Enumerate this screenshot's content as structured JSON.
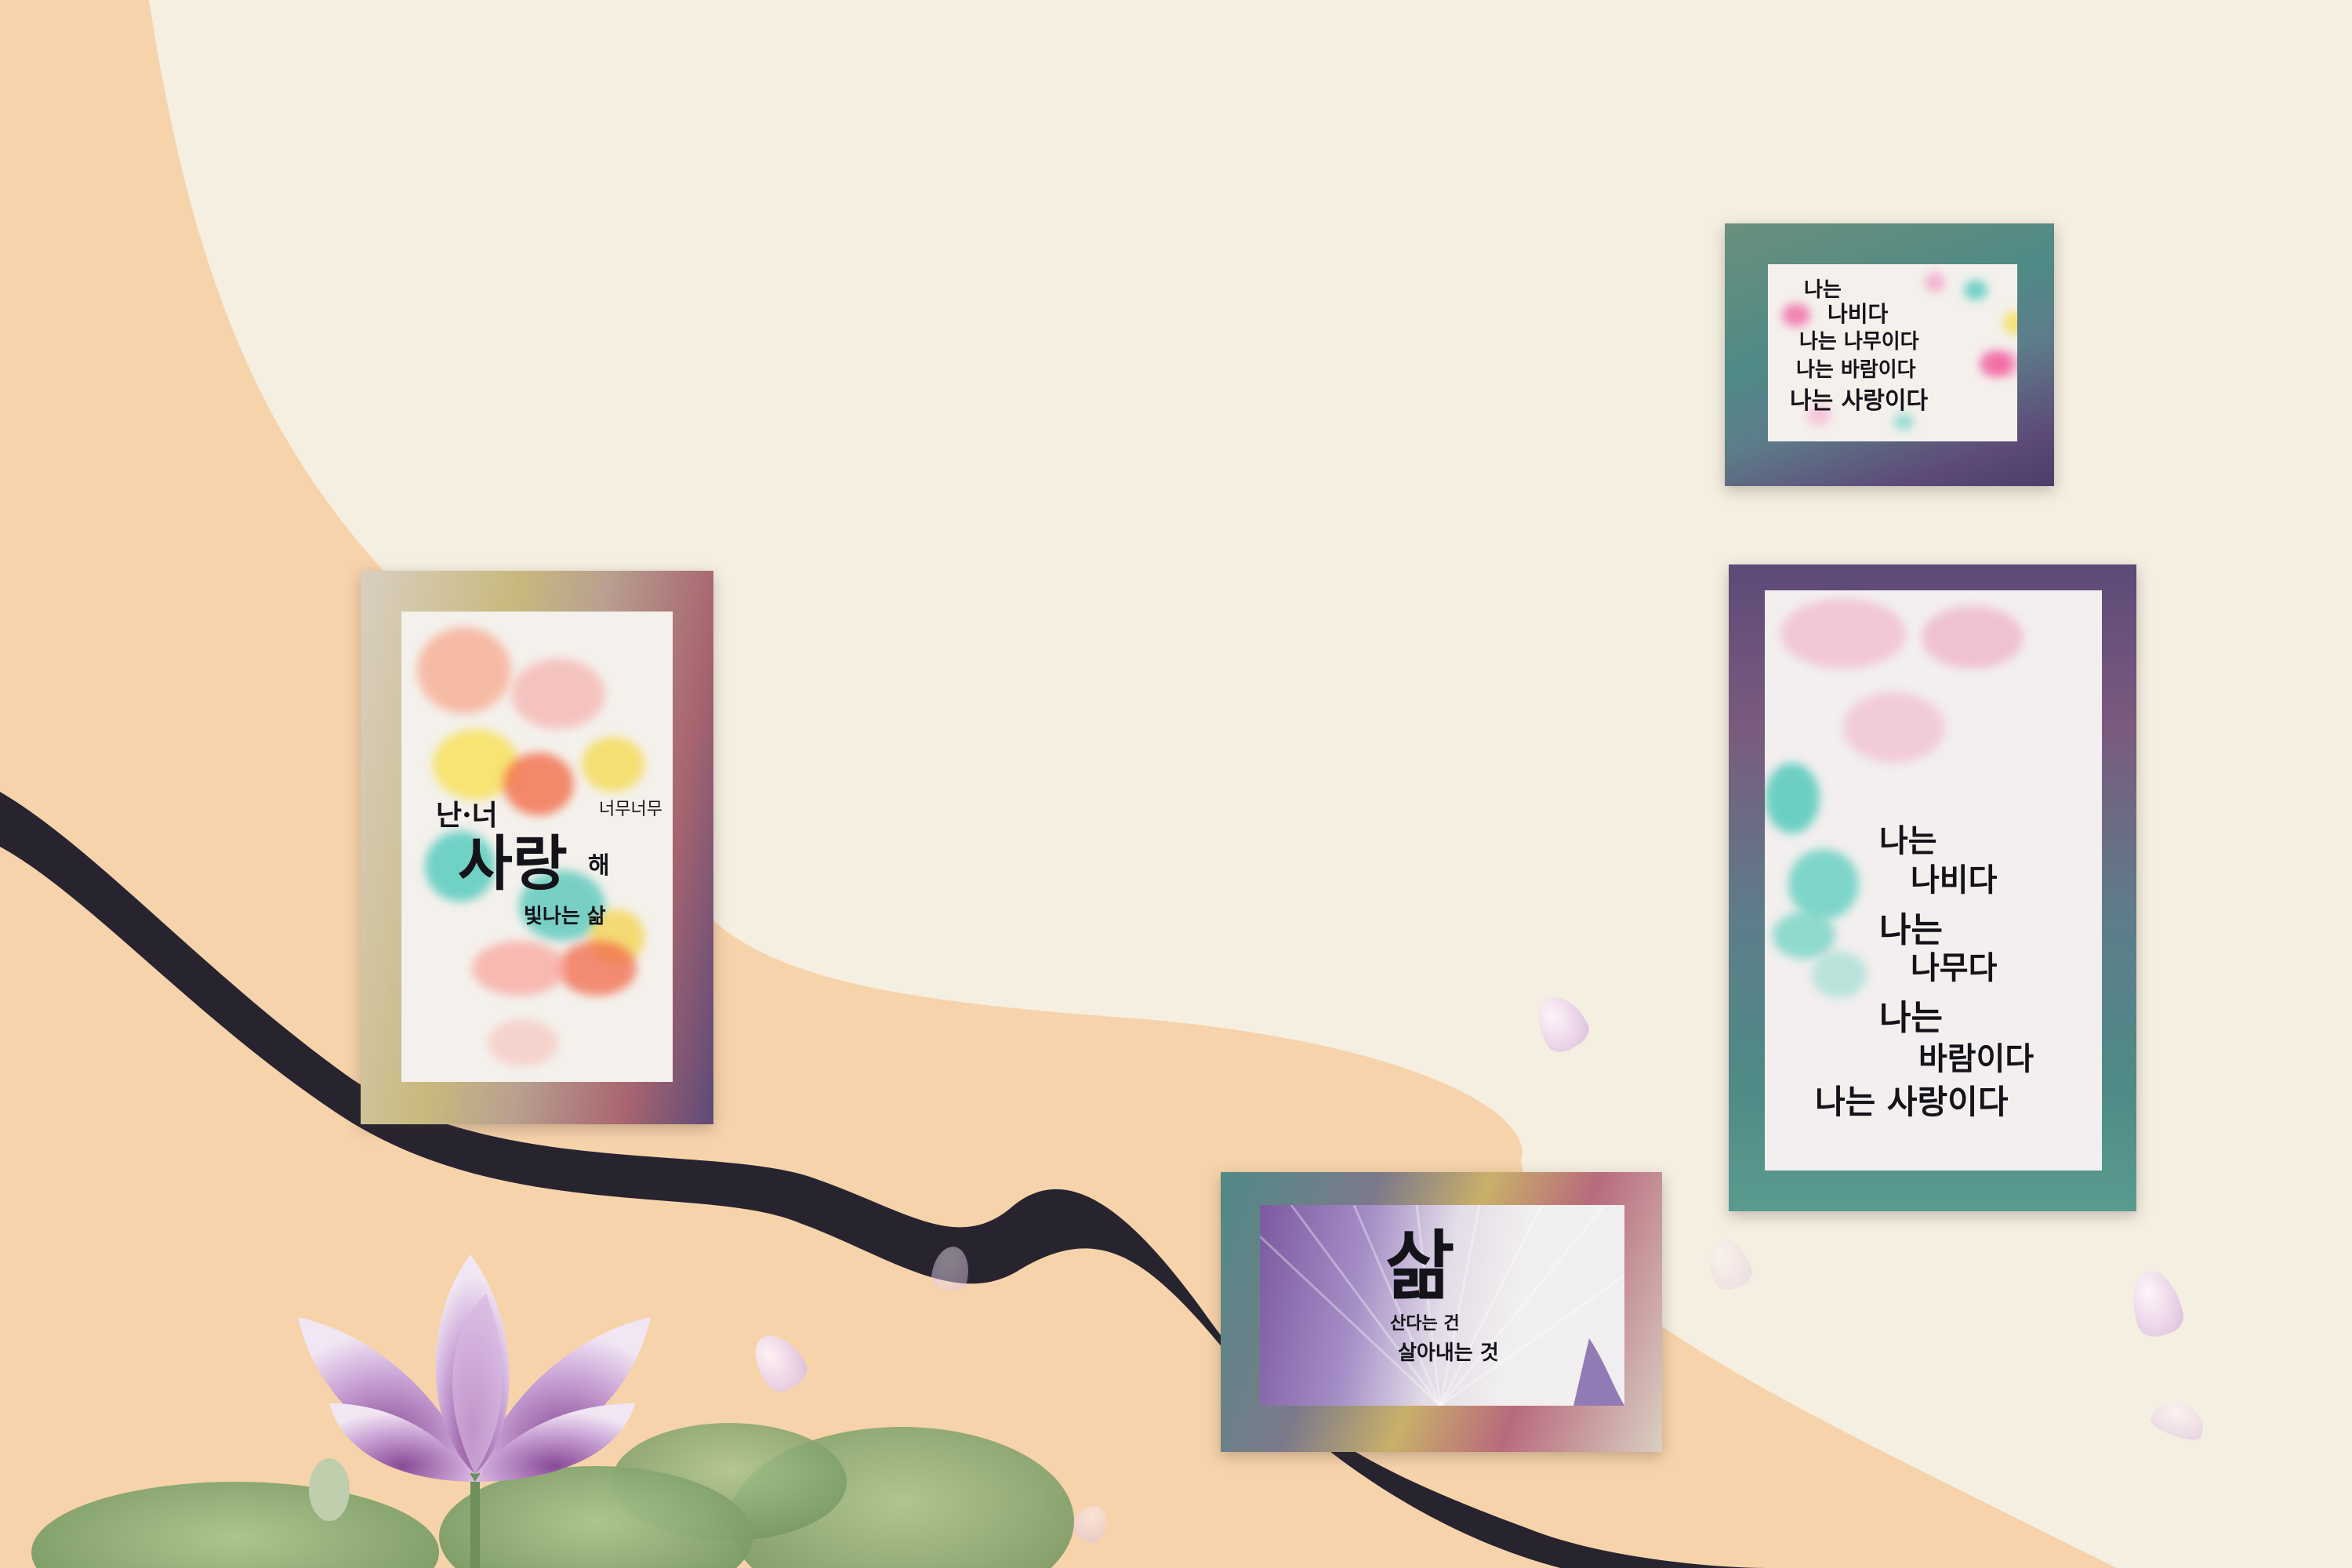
{
  "cards": {
    "left": {
      "line1": "난·너",
      "line2": "너무너무",
      "main": "사랑",
      "suffix": "해",
      "line4": "빛나는 삶"
    },
    "top_right": {
      "lines": [
        "나는",
        "나비다",
        "나는 나무이다",
        "나는 바람이다",
        "나는 사랑이다"
      ]
    },
    "right": {
      "lines": [
        "나는",
        "나비다",
        "나는",
        "나무다",
        "나는",
        "바람이다",
        "나는 사랑이다"
      ]
    },
    "bottom": {
      "main": "삶",
      "sub1": "산다는 건",
      "sub2": "살아내는 것"
    }
  },
  "colors": {
    "background": "#f5efe1",
    "peach_wave": "#f7d3ab",
    "dark_wave": "#272430",
    "frame_teal": "#4f8a86",
    "frame_purple": "#5d4a78",
    "frame_gold": "#c9b06a",
    "frame_rose": "#b86a7c",
    "lotus": "#b78bc7",
    "leaf": "#8fae75"
  }
}
